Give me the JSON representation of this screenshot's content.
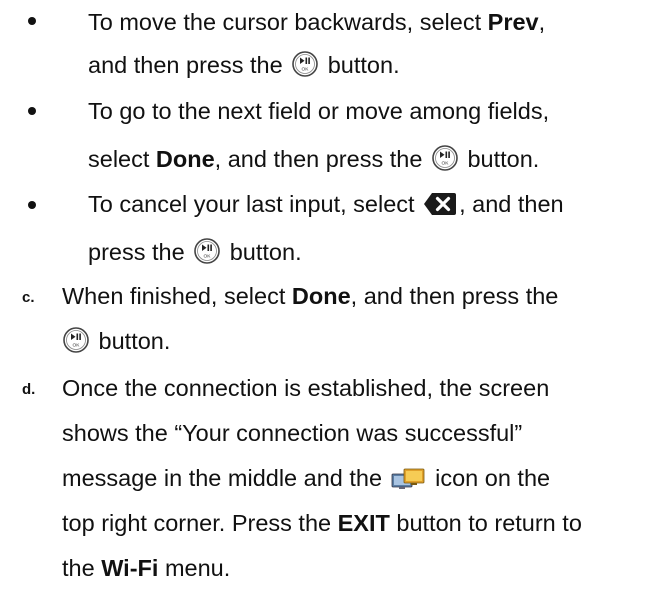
{
  "bullets": [
    {
      "line1_pre": "To move the cursor backwards, select ",
      "line1_bold": "Prev",
      "line1_post": ",",
      "line2_pre": "and then press the ",
      "line2_post": " button."
    },
    {
      "line1": "To go to the next field or move among fields,",
      "line2_pre": "select ",
      "line2_bold": "Done",
      "line2_mid": ", and then press the ",
      "line2_post": " button."
    },
    {
      "line1_pre": "To cancel your last input, select ",
      "line1_post": ", and then",
      "line2_pre": "press the ",
      "line2_post": " button."
    }
  ],
  "step_c": {
    "letter": "c.",
    "line1_pre": "When finished, select ",
    "line1_bold": "Done",
    "line1_post": ", and then press the",
    "line2_post": " button."
  },
  "step_d": {
    "letter": "d.",
    "line1": "Once the connection is established, the screen",
    "line2": "shows the “Your connection was successful”",
    "line3_pre": "message in the middle and the ",
    "line3_post": " icon on the",
    "line4_pre": "top right corner. Press the ",
    "line4_bold": "EXIT",
    "line4_post": " button to return to",
    "line5_pre": "the ",
    "line5_bold": "Wi-Fi",
    "line5_post": " menu."
  },
  "icons": {
    "ok_button": "play-pause-ok-button-icon",
    "delete": "backspace-delete-icon",
    "network": "network-connected-icon"
  }
}
